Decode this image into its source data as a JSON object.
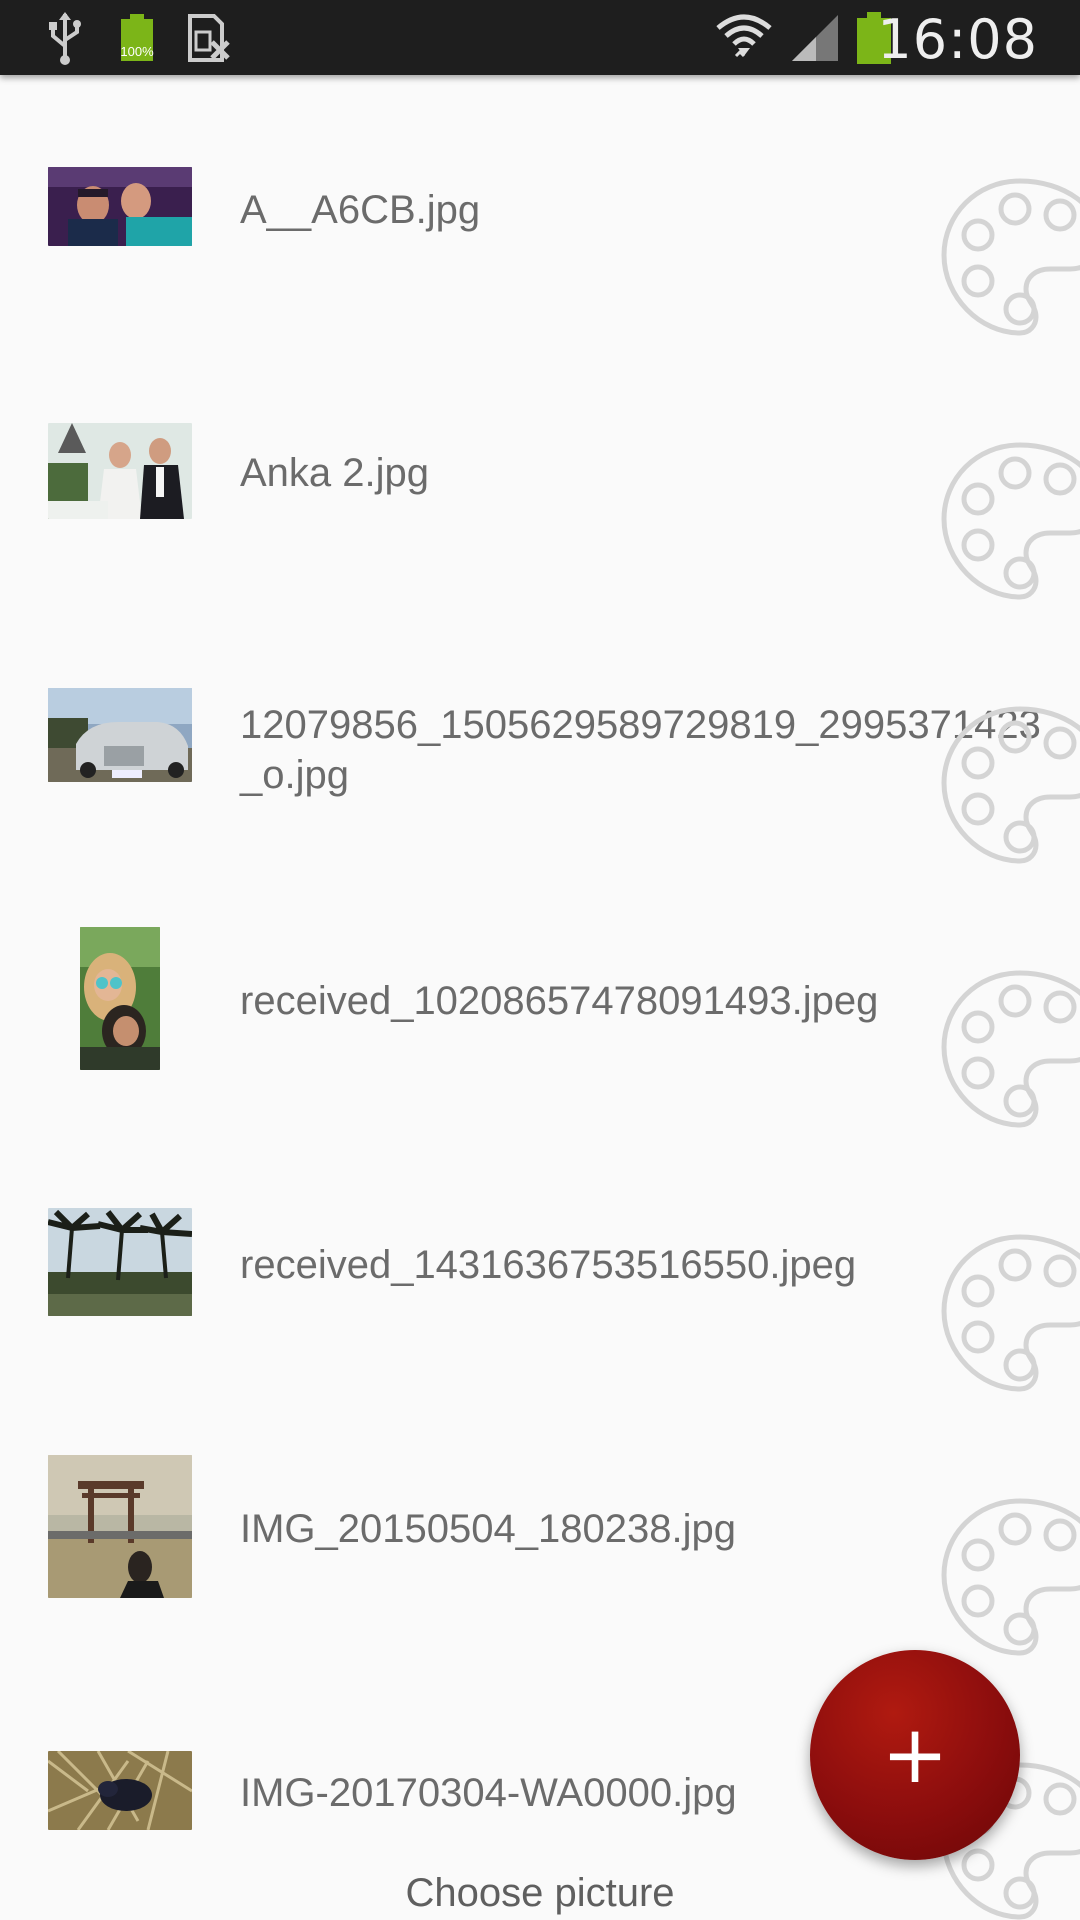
{
  "status_bar": {
    "time": "16:08",
    "battery_small_label": "100%",
    "icons": [
      "usb-icon",
      "battery-icon",
      "sim-card-icon",
      "wifi-icon",
      "signal-icon",
      "battery-status-icon"
    ]
  },
  "files": [
    {
      "name": "A__A6CB.jpg",
      "thumb": "selfie-couple"
    },
    {
      "name": "Anka 2.jpg",
      "thumb": "wedding"
    },
    {
      "name": "12079856_1505629589729819_2995371423\n_o.jpg",
      "thumb": "vintage-car"
    },
    {
      "name": "received_10208657478091493.jpeg",
      "thumb": "portrait"
    },
    {
      "name": "received_1431636753516550.jpeg",
      "thumb": "palm-trees"
    },
    {
      "name": "IMG_20150504_180238.jpg",
      "thumb": "torii-gate"
    },
    {
      "name": "IMG-20170304-WA0000.jpg",
      "thumb": "animal-straw"
    }
  ],
  "fab": {
    "label": "+",
    "icon": "add-icon"
  },
  "footer": {
    "label": "Choose picture"
  },
  "colors": {
    "fab": "#8b0d0d",
    "status_bar": "#1e1e1e",
    "battery": "#7cb518",
    "text": "#6b6b6b"
  }
}
